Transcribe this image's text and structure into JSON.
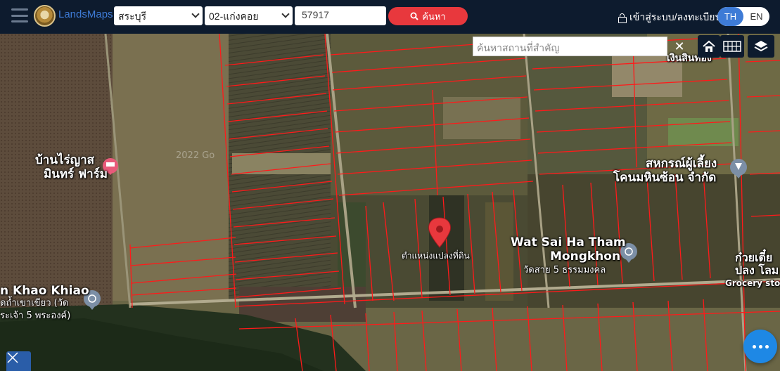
{
  "header": {
    "brand": "LandsMaps",
    "province": "สระบุรี",
    "district": "02-แก่งคอย",
    "parcel_number": "57917",
    "search_label": "ค้นหา",
    "login_label": "เข้าสู่ระบบ/ลงทะเบียน",
    "lang_th": "TH",
    "lang_en": "EN"
  },
  "map": {
    "place_search_placeholder": "ค้นหาสถานที่สำคัญ",
    "clear_label": "✕",
    "parcel_marker_label": "ตำแหน่งแปลงที่ดิน",
    "labels": {
      "farm_line1": "บ้านไร่ญาส",
      "farm_line2": "มินทร์ ฟาร์ม",
      "coop_line1": "สหกรณ์ผู้เลี้ยง",
      "coop_line2": "โคนมหินซ้อน จำกัด",
      "temple_en_line1": "Wat Sai Ha Tham",
      "temple_en_line2": "Mongkhon",
      "temple_th": "วัดสาย 5 ธรรมมงคล",
      "khao_khiao_en": "n Khao Khiao",
      "khao_khiao_th1": "ดถ้ำเขาเขียว (วัด",
      "khao_khiao_th2": "ระเจ้า 5 พระองค์)",
      "right_th1": "ก๋วยเตี๋ย",
      "right_th2": "ปลง โลม",
      "grocery": "Grocery sto",
      "top_right": "เงินสินทอง",
      "watermark": "2022 Go"
    },
    "colors": {
      "parcel_line": "#ff1a1a",
      "marker": "#e8383d",
      "topbar": "#0d1b2e",
      "accent": "#3e7bd6"
    }
  }
}
